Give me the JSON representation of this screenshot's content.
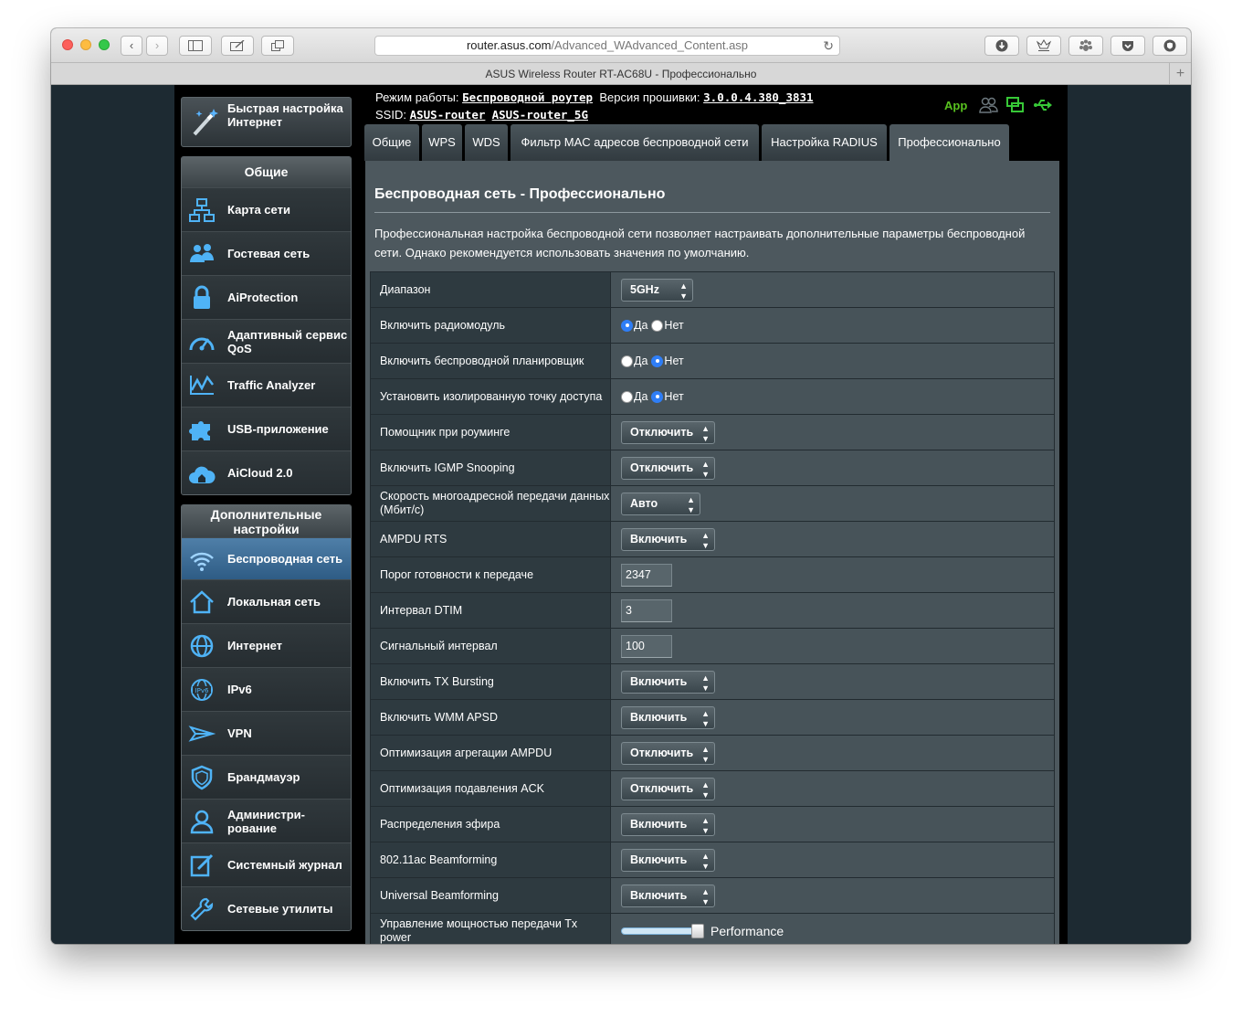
{
  "browser": {
    "url_host": "router.asus.com",
    "url_path": "/Advanced_WAdvanced_Content.asp",
    "tab_title": "ASUS Wireless Router RT-AC68U - Профессионально"
  },
  "sidebar": {
    "quick_setup": "Быстрая настройка Интернет",
    "general_title": "Общие",
    "general_items": [
      {
        "label": "Карта сети",
        "icon": "network-map-icon"
      },
      {
        "label": "Гостевая сеть",
        "icon": "guest-network-icon"
      },
      {
        "label": "AiProtection",
        "icon": "lock-icon"
      },
      {
        "label": "Адаптивный сервис QoS",
        "icon": "speedometer-icon"
      },
      {
        "label": "Traffic Analyzer",
        "icon": "traffic-chart-icon"
      },
      {
        "label": "USB-приложение",
        "icon": "puzzle-icon"
      },
      {
        "label": "AiCloud 2.0",
        "icon": "cloud-house-icon"
      }
    ],
    "advanced_title": "Дополнительные настройки",
    "advanced_items": [
      {
        "label": "Беспроводная сеть",
        "icon": "wifi-icon",
        "active": true
      },
      {
        "label": "Локальная сеть",
        "icon": "home-icon"
      },
      {
        "label": "Интернет",
        "icon": "globe-icon"
      },
      {
        "label": "IPv6",
        "icon": "ipv6-globe-icon"
      },
      {
        "label": "VPN",
        "icon": "vpn-icon"
      },
      {
        "label": "Брандмауэр",
        "icon": "shield-icon"
      },
      {
        "label": "Администри-рование",
        "icon": "admin-user-icon"
      },
      {
        "label": "Системный журнал",
        "icon": "log-edit-icon"
      },
      {
        "label": "Сетевые утилиты",
        "icon": "tools-icon"
      }
    ]
  },
  "header": {
    "mode_label": "Режим работы:",
    "mode_value": "Беспроводной роутер",
    "firmware_label": "Версия прошивки:",
    "firmware_value": "3.0.0.4.380_3831",
    "ssid_label": "SSID:",
    "ssid_1": "ASUS-router",
    "ssid_2": "ASUS-router_5G",
    "app_label": "App"
  },
  "tabs": [
    "Общие",
    "WPS",
    "WDS",
    "Фильтр MAC адресов беспроводной сети",
    "Настройка RADIUS",
    "Профессионально"
  ],
  "panel": {
    "title": "Беспроводная сеть - Профессионально",
    "description": "Профессиональная настройка беспроводной сети позволяет настраивать дополнительные параметры беспроводной сети. Однако рекомендуется использовать значения по умолчанию."
  },
  "labels": {
    "yes": "Да",
    "no": "Нет"
  },
  "settings": [
    {
      "label": "Диапазон",
      "type": "select",
      "value": "5GHz"
    },
    {
      "label": "Включить радиомодуль",
      "type": "radio",
      "value": "yes"
    },
    {
      "label": "Включить беспроводной планировщик",
      "type": "radio",
      "value": "no"
    },
    {
      "label": "Установить изолированную точку доступа",
      "type": "radio",
      "value": "no"
    },
    {
      "label": "Помощник при роуминге",
      "type": "select",
      "value": "Отключить"
    },
    {
      "label": "Включить IGMP Snooping",
      "type": "select",
      "value": "Отключить"
    },
    {
      "label": "Скорость многоадресной передачи данных (Мбит/с)",
      "type": "select",
      "value": "Авто"
    },
    {
      "label": "AMPDU RTS",
      "type": "select",
      "value": "Включить"
    },
    {
      "label": "Порог готовности к передаче",
      "type": "input",
      "value": "2347"
    },
    {
      "label": "Интервал DTIM",
      "type": "input",
      "value": "3"
    },
    {
      "label": "Сигнальный интервал",
      "type": "input",
      "value": "100"
    },
    {
      "label": "Включить TX Bursting",
      "type": "select",
      "value": "Включить"
    },
    {
      "label": "Включить WMM APSD",
      "type": "select",
      "value": "Включить"
    },
    {
      "label": "Оптимизация агрегации AMPDU",
      "type": "select",
      "value": "Отключить"
    },
    {
      "label": "Оптимизация подавления ACK",
      "type": "select",
      "value": "Отключить"
    },
    {
      "label": "Распределения эфира",
      "type": "select",
      "value": "Включить"
    },
    {
      "label": "802.11ac Beamforming",
      "type": "select",
      "value": "Включить"
    },
    {
      "label": "Universal Beamforming",
      "type": "select",
      "value": "Включить"
    },
    {
      "label": "Управление мощностью передачи Tx power",
      "type": "slider",
      "value": "Performance",
      "level": 1.0
    }
  ],
  "colors": {
    "accent": "#2f7ef6",
    "app_green": "#58c21f",
    "active_menu": "#3d6d96"
  }
}
